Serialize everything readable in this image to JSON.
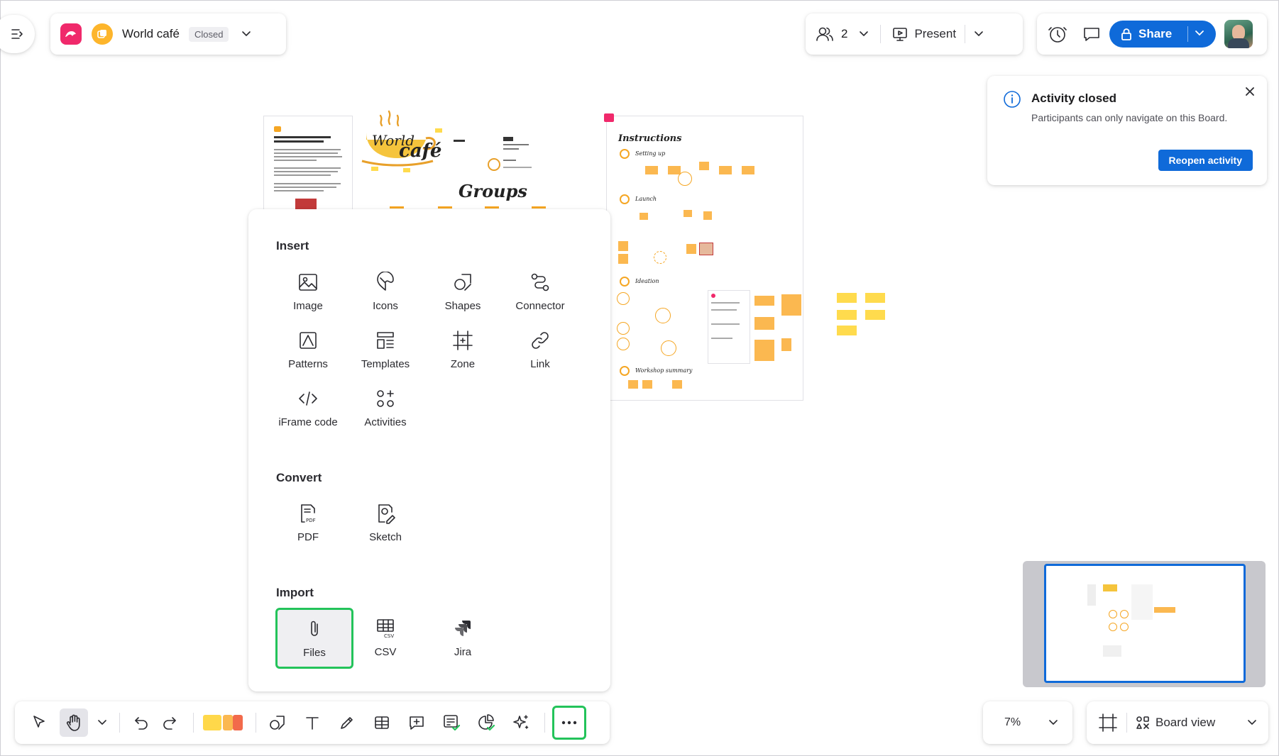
{
  "board": {
    "name": "World café",
    "status": "Closed"
  },
  "collaborators": {
    "count": "2",
    "present_label": "Present"
  },
  "share": {
    "label": "Share"
  },
  "notification": {
    "title": "Activity closed",
    "message": "Participants can only navigate on this Board.",
    "action_label": "Reopen activity"
  },
  "insert_panel": {
    "insert_title": "Insert",
    "insert_items": [
      "Image",
      "Icons",
      "Shapes",
      "Connector",
      "Patterns",
      "Templates",
      "Zone",
      "Link",
      "iFrame code",
      "Activities"
    ],
    "convert_title": "Convert",
    "convert_items": [
      "PDF",
      "Sketch"
    ],
    "import_title": "Import",
    "import_items": [
      "Files",
      "CSV",
      "Jira"
    ],
    "active_item": "Files"
  },
  "zoom": {
    "value": "7%"
  },
  "view": {
    "label": "Board view"
  },
  "canvas": {
    "instructions_title": "Instructions",
    "steps": [
      "Setting up",
      "Launch",
      "Ideation",
      "Workshop summary"
    ],
    "groups_title": "Groups",
    "logo_text": "World café"
  },
  "colors": {
    "accent": "#0f6ad9",
    "highlight": "#23c35a",
    "brand": "#f0296b",
    "sticky_orange": "#fbb850",
    "sticky_yellow": "#ffdb4d"
  }
}
